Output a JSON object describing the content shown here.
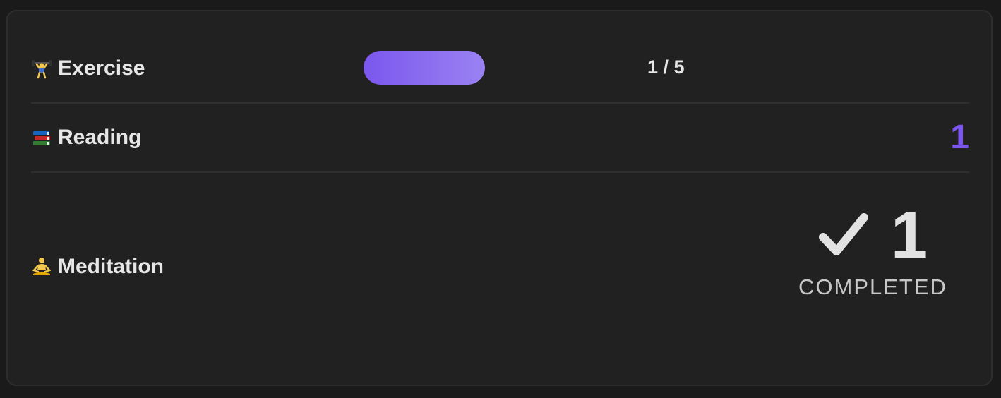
{
  "habits": {
    "exercise": {
      "icon": "weight-lifter-icon",
      "name": "Exercise",
      "progress_fraction": 0.2,
      "progress_text": "1 / 5"
    },
    "reading": {
      "icon": "books-icon",
      "name": "Reading",
      "count": "1"
    },
    "meditation": {
      "icon": "meditating-person-icon",
      "name": "Meditation",
      "count": "1",
      "status_label": "COMPLETED",
      "status_icon": "check-icon"
    }
  },
  "colors": {
    "accent": "#7b55ec",
    "progress_gradient_start": "#7b57ee",
    "progress_gradient_end": "#9a82f2",
    "card_background": "#212121",
    "page_background": "#1a1a1a",
    "text_primary": "#e6e6e6"
  }
}
